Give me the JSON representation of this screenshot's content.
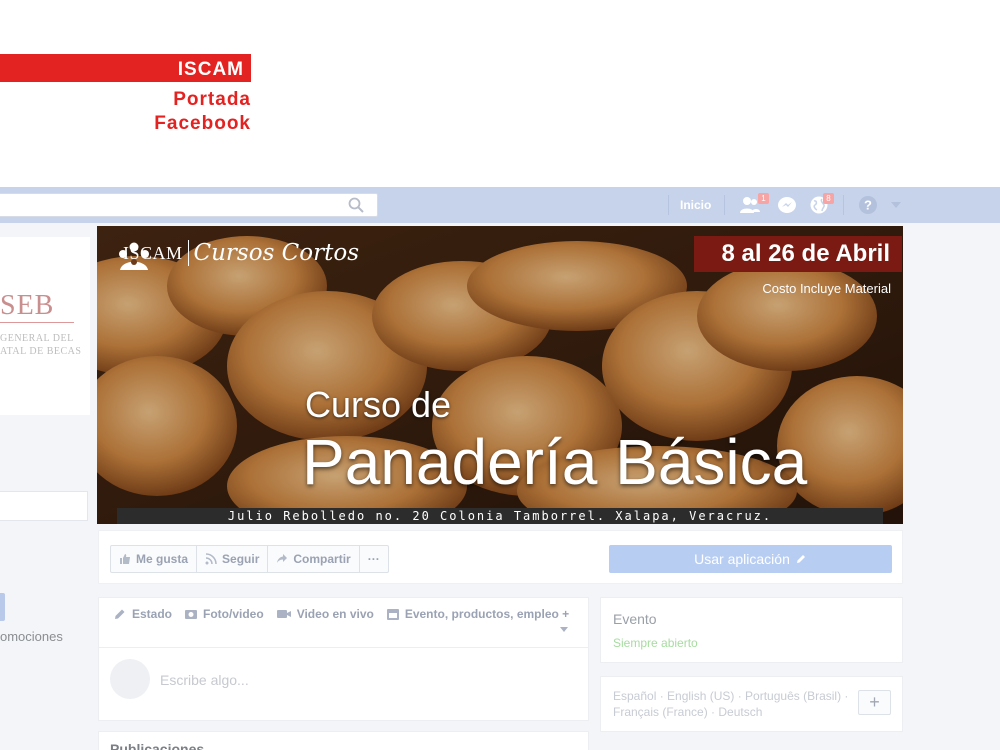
{
  "header": {
    "brand_label": "ISCAM",
    "title_line1": "Portada",
    "title_line2": "Facebook"
  },
  "fb_topbar": {
    "nav_home": "Inicio",
    "friends_badge": "1",
    "notifications_badge": "8"
  },
  "left_column": {
    "logo_text": "SEB",
    "logo_line1": "GENERAL DEL",
    "logo_line2": "ATAL DE BECAS",
    "promo_text": "omociones"
  },
  "cover": {
    "brand_name": "ISCAM",
    "brand_tagline": "Cursos Cortos",
    "dates": "8 al 26 de Abril",
    "price_note": "Costo Incluye Material",
    "course_prefix": "Curso de",
    "course_name": "Panadería Básica",
    "address": "Julio Rebolledo no. 20 Colonia Tamborrel. Xalapa, Veracruz."
  },
  "page_actions": {
    "like": "Me gusta",
    "follow": "Seguir",
    "share": "Compartir",
    "more": "···",
    "use_app": "Usar aplicación"
  },
  "composer": {
    "tab_status": "Estado",
    "tab_photo": "Foto/video",
    "tab_live": "Video en vivo",
    "tab_event": "Evento, productos, empleo +",
    "placeholder": "Escribe algo..."
  },
  "posts": {
    "title": "Publicaciones"
  },
  "evento": {
    "title": "Evento",
    "subtitle": "Siempre abierto"
  },
  "languages": {
    "line1": "Español · English (US) · Português (Brasil) ·",
    "line2": "Français (France) · Deutsch",
    "add": "+"
  }
}
